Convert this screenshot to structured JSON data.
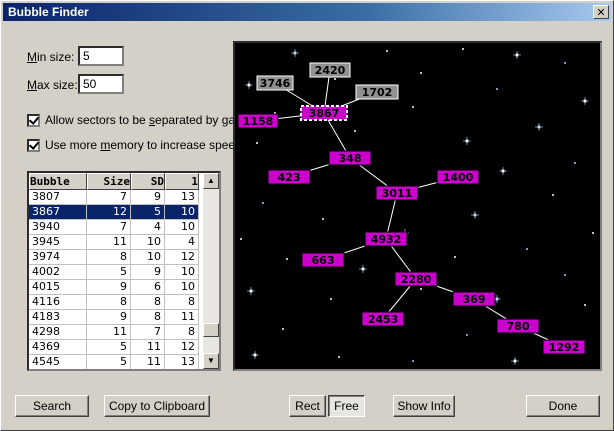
{
  "window": {
    "title": "Bubble Finder",
    "close_glyph": "✕"
  },
  "params": {
    "min_size_label_u": "M",
    "min_size_label_rest": "in size:",
    "min_size_value": "5",
    "max_size_label_u": "M",
    "max_size_label_rest": "ax size:",
    "max_size_value": "50"
  },
  "options": {
    "allow_pre": "Allow sectors to be ",
    "allow_u": "s",
    "allow_post": "eparated by gate",
    "memory_pre": "Use more ",
    "memory_u": "m",
    "memory_post": "emory to increase speed",
    "allow_checked": true,
    "memory_checked": true
  },
  "table": {
    "columns": [
      "Bubble",
      "Size",
      "SD",
      "1"
    ],
    "selected_index": 1,
    "rows": [
      [
        "3807",
        "7",
        "9",
        "13"
      ],
      [
        "3867",
        "12",
        "5",
        "10"
      ],
      [
        "3940",
        "7",
        "4",
        "10"
      ],
      [
        "3945",
        "11",
        "10",
        "4"
      ],
      [
        "3974",
        "8",
        "10",
        "12"
      ],
      [
        "4002",
        "5",
        "9",
        "10"
      ],
      [
        "4015",
        "9",
        "6",
        "10"
      ],
      [
        "4116",
        "8",
        "8",
        "8"
      ],
      [
        "4183",
        "9",
        "8",
        "11"
      ],
      [
        "4298",
        "11",
        "7",
        "8"
      ],
      [
        "4369",
        "5",
        "11",
        "12"
      ],
      [
        "4545",
        "5",
        "11",
        "13"
      ]
    ],
    "scroll_up_glyph": "▲",
    "scroll_down_glyph": "▼"
  },
  "graph": {
    "background": "#000000",
    "node_color": "#cc00cc",
    "gate_color": "#909090",
    "selected": "3867",
    "nodes": [
      {
        "id": "3746",
        "kind": "gate"
      },
      {
        "id": "2420",
        "kind": "gate"
      },
      {
        "id": "1702",
        "kind": "gate"
      },
      {
        "id": "3867",
        "kind": "selected"
      },
      {
        "id": "1158",
        "kind": "sector"
      },
      {
        "id": "348",
        "kind": "sector"
      },
      {
        "id": "423",
        "kind": "sector"
      },
      {
        "id": "3011",
        "kind": "sector"
      },
      {
        "id": "1400",
        "kind": "sector"
      },
      {
        "id": "4932",
        "kind": "sector"
      },
      {
        "id": "663",
        "kind": "sector"
      },
      {
        "id": "2280",
        "kind": "sector"
      },
      {
        "id": "369",
        "kind": "sector"
      },
      {
        "id": "2453",
        "kind": "sector"
      },
      {
        "id": "780",
        "kind": "sector"
      },
      {
        "id": "1292",
        "kind": "sector"
      }
    ],
    "edges": [
      [
        "3746",
        "3867"
      ],
      [
        "2420",
        "3867"
      ],
      [
        "1702",
        "3867"
      ],
      [
        "1158",
        "3867"
      ],
      [
        "3867",
        "348"
      ],
      [
        "348",
        "423"
      ],
      [
        "348",
        "3011"
      ],
      [
        "3011",
        "1400"
      ],
      [
        "3011",
        "4932"
      ],
      [
        "4932",
        "663"
      ],
      [
        "4932",
        "2280"
      ],
      [
        "2280",
        "2453"
      ],
      [
        "2280",
        "369"
      ],
      [
        "369",
        "780"
      ],
      [
        "780",
        "1292"
      ]
    ]
  },
  "buttons": {
    "search": "Search",
    "copy": "Copy to Clipboard",
    "rect": "Rect",
    "free": "Free",
    "show_info": "Show Info",
    "done": "Done"
  }
}
